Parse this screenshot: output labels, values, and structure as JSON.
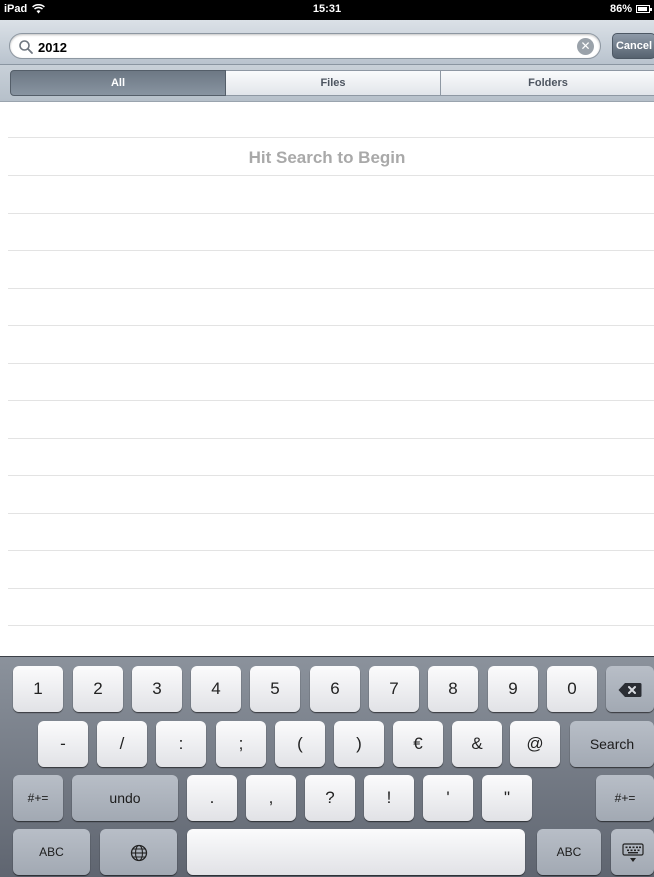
{
  "status_bar": {
    "device": "iPad",
    "time": "15:31",
    "battery": "86%",
    "battery_level": 0.86
  },
  "search": {
    "value": "2012",
    "cancel_label": "Cancel"
  },
  "segments": [
    {
      "label": "All",
      "selected": true
    },
    {
      "label": "Files",
      "selected": false
    },
    {
      "label": "Folders",
      "selected": false
    }
  ],
  "list": {
    "hint": "Hit Search to Begin"
  },
  "keyboard": {
    "row1": [
      "1",
      "2",
      "3",
      "4",
      "5",
      "6",
      "7",
      "8",
      "9",
      "0"
    ],
    "row2": [
      "-",
      "/",
      ":",
      ";",
      "(",
      ")",
      "€",
      "&",
      "@"
    ],
    "search_label": "Search",
    "row3_left": "#+=",
    "undo_label": "undo",
    "row3": [
      ".",
      ",",
      "?",
      "!",
      "'",
      "\""
    ],
    "row3_right": "#+=",
    "abc_left": "ABC",
    "abc_right": "ABC"
  },
  "colors": {
    "status_bg": "#000000",
    "hint_text": "#a9a9a9",
    "selected_segment": "#6d7884"
  }
}
